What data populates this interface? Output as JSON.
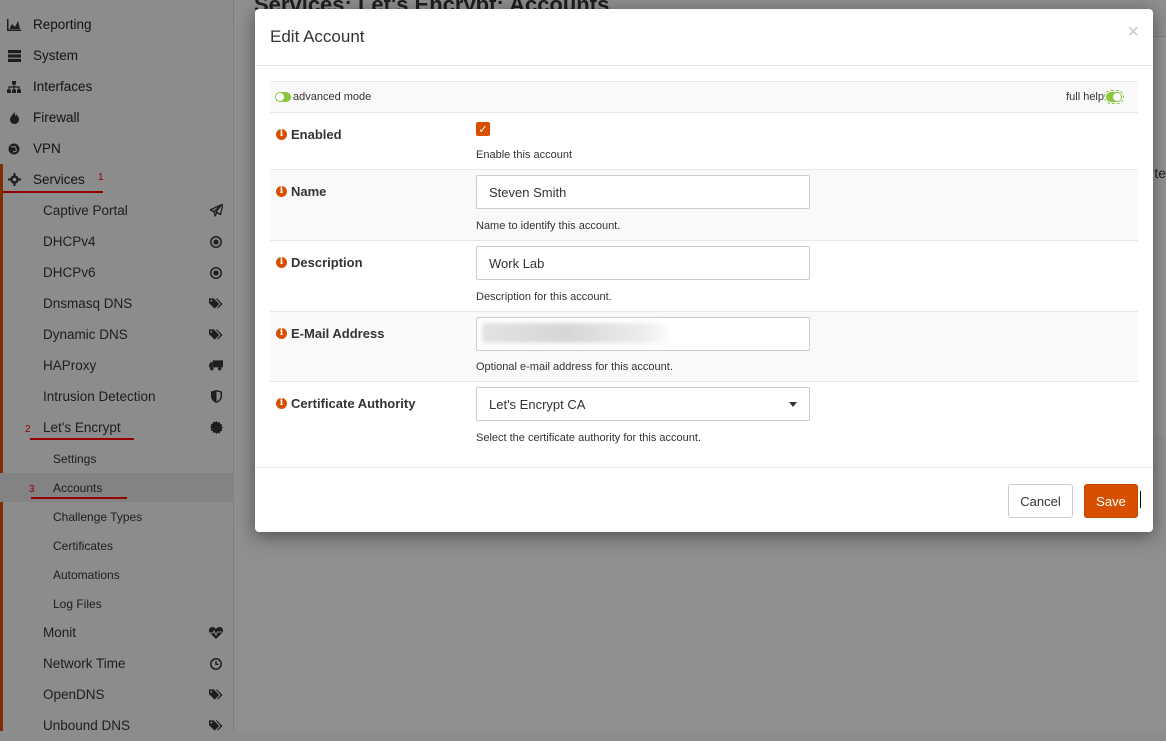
{
  "sidebar": {
    "top_items": [
      {
        "label": "Reporting",
        "icon": "chart-area-icon"
      },
      {
        "label": "System",
        "icon": "server-icon"
      },
      {
        "label": "Interfaces",
        "icon": "sitemap-icon"
      },
      {
        "label": "Firewall",
        "icon": "fire-icon"
      },
      {
        "label": "VPN",
        "icon": "globe-icon"
      },
      {
        "label": "Services",
        "icon": "gear-icon"
      }
    ],
    "services_items": [
      {
        "label": "Captive Portal",
        "icon": "paper-plane-icon"
      },
      {
        "label": "DHCPv4",
        "icon": "bullseye-icon"
      },
      {
        "label": "DHCPv6",
        "icon": "bullseye-icon"
      },
      {
        "label": "Dnsmasq DNS",
        "icon": "tags-icon"
      },
      {
        "label": "Dynamic DNS",
        "icon": "tags-icon"
      },
      {
        "label": "HAProxy",
        "icon": "truck-icon"
      },
      {
        "label": "Intrusion Detection",
        "icon": "shield-icon"
      },
      {
        "label": "Let's Encrypt",
        "icon": "certificate-icon"
      }
    ],
    "letsencrypt_items": [
      {
        "label": "Settings"
      },
      {
        "label": "Accounts"
      },
      {
        "label": "Challenge Types"
      },
      {
        "label": "Certificates"
      },
      {
        "label": "Automations"
      },
      {
        "label": "Log Files"
      }
    ],
    "more_items": [
      {
        "label": "Monit",
        "icon": "heartbeat-icon"
      },
      {
        "label": "Network Time",
        "icon": "clock-icon"
      },
      {
        "label": "OpenDNS",
        "icon": "tags-icon"
      },
      {
        "label": "Unbound DNS",
        "icon": "tags-icon"
      }
    ],
    "annotations": {
      "one": "1",
      "two": "2",
      "three": "3"
    }
  },
  "page": {
    "title": "Services: Let's Encrypt: Accounts",
    "cut_text": "te"
  },
  "modal": {
    "title": "Edit Account",
    "close": "×",
    "advanced_mode_label": "advanced mode",
    "full_help_label": "full help",
    "fields": {
      "enabled": {
        "label": "Enabled",
        "help": "Enable this account",
        "checked": true
      },
      "name": {
        "label": "Name",
        "value": "Steven Smith",
        "help": "Name to identify this account."
      },
      "description": {
        "label": "Description",
        "value": "Work Lab",
        "help": "Description for this account."
      },
      "email": {
        "label": "E-Mail Address",
        "value": "",
        "help": "Optional e-mail address for this account."
      },
      "ca": {
        "label": "Certificate Authority",
        "value": "Let's Encrypt CA",
        "help": "Select the certificate authority for this account."
      }
    },
    "buttons": {
      "cancel": "Cancel",
      "save": "Save"
    }
  },
  "colors": {
    "accent": "#d94f00",
    "toggle_green": "#8cc63f",
    "annotation_red": "#ff0000"
  }
}
